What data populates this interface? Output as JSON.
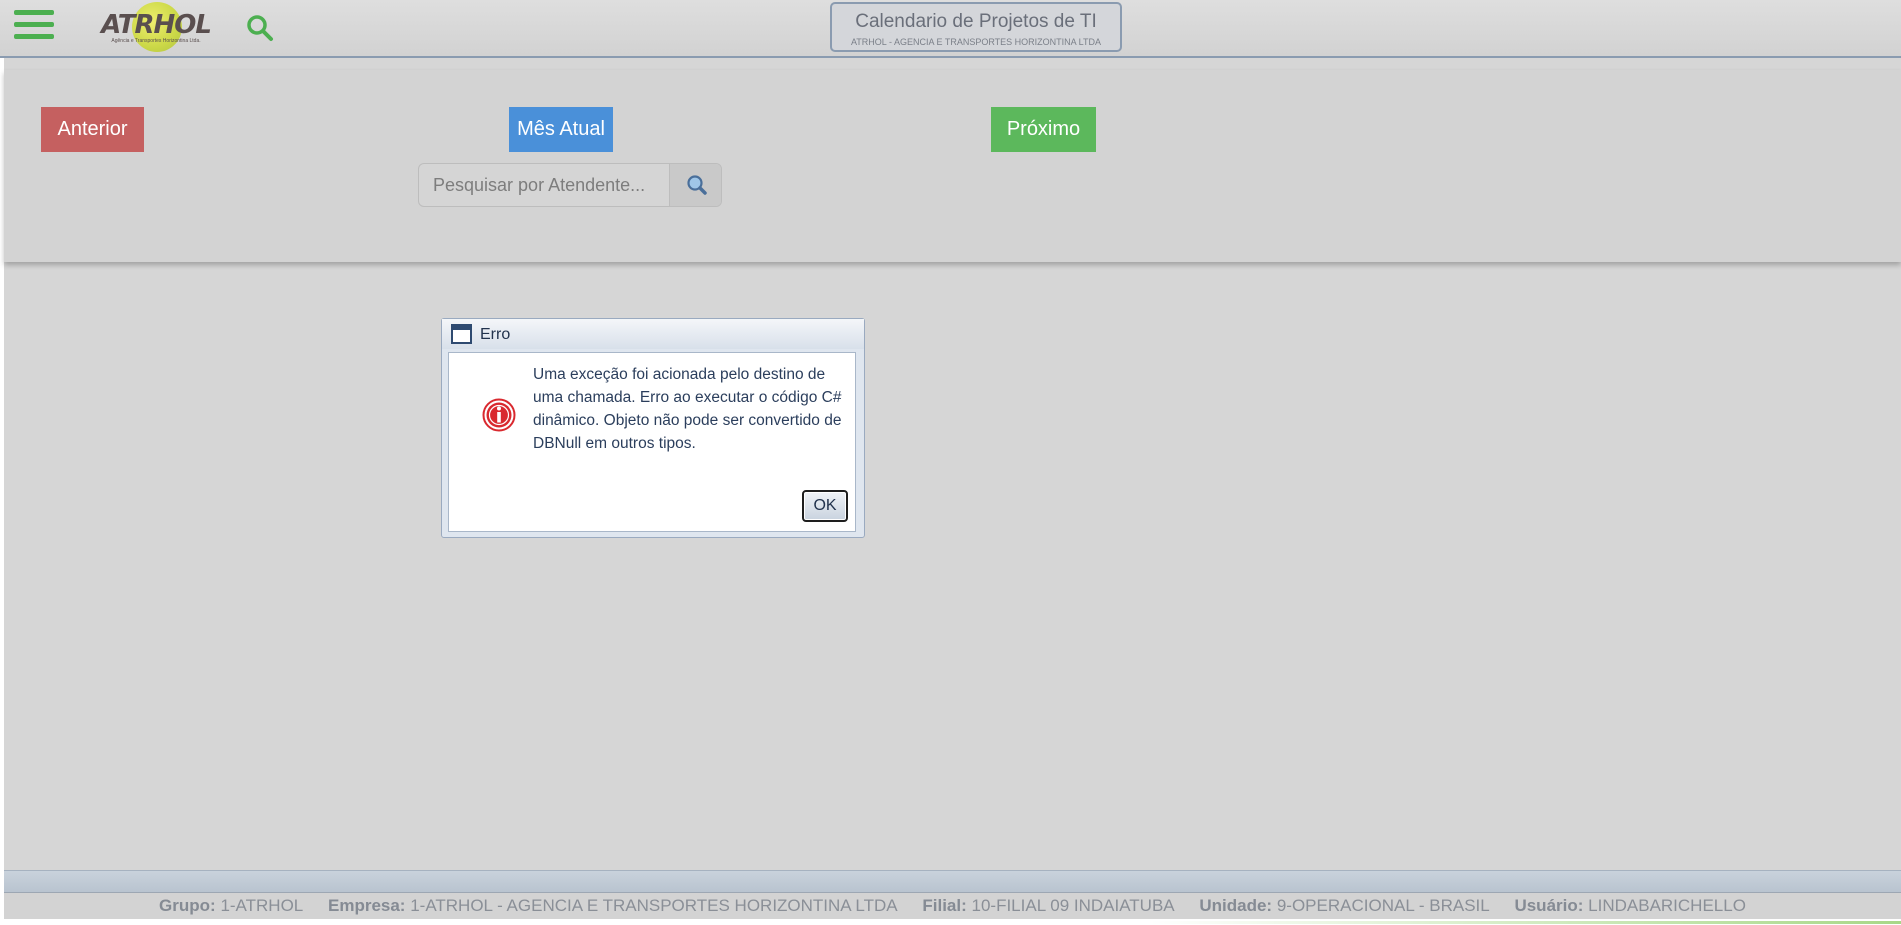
{
  "header": {
    "logo_text": "ATRHOL",
    "logo_subtitle": "Agência e Transportes Horizontina Ltda.",
    "title": "Calendario de Projetos de TI",
    "subtitle": "ATRHOL - AGENCIA E TRANSPORTES HORIZONTINA LTDA"
  },
  "controls": {
    "prev_label": "Anterior",
    "current_label": "Mês Atual",
    "next_label": "Próximo",
    "search_placeholder": "Pesquisar por Atendente..."
  },
  "dialog": {
    "title": "Erro",
    "message": "Uma exceção foi acionada pelo destino de uma chamada. Erro ao executar o código C# dinâmico. Objeto não pode ser convertido de DBNull em outros tipos.",
    "ok_label": "OK"
  },
  "status": {
    "grupo_label": "Grupo:",
    "grupo_value": "1-ATRHOL",
    "empresa_label": "Empresa:",
    "empresa_value": "1-ATRHOL - AGENCIA E TRANSPORTES HORIZONTINA LTDA",
    "filial_label": "Filial:",
    "filial_value": "10-FILIAL 09 INDAIATUBA",
    "unidade_label": "Unidade:",
    "unidade_value": "9-OPERACIONAL - BRASIL",
    "usuario_label": "Usuário:",
    "usuario_value": "LINDABARICHELLO"
  },
  "colors": {
    "menu_green": "#4caf50",
    "prev_red": "#c56060",
    "current_blue": "#4a90d9",
    "next_green": "#5cb85c",
    "error_red": "#d9292f"
  },
  "icons": {
    "menu": "hamburger-menu-icon",
    "search": "search-icon",
    "window": "window-icon",
    "error": "error-info-icon"
  }
}
